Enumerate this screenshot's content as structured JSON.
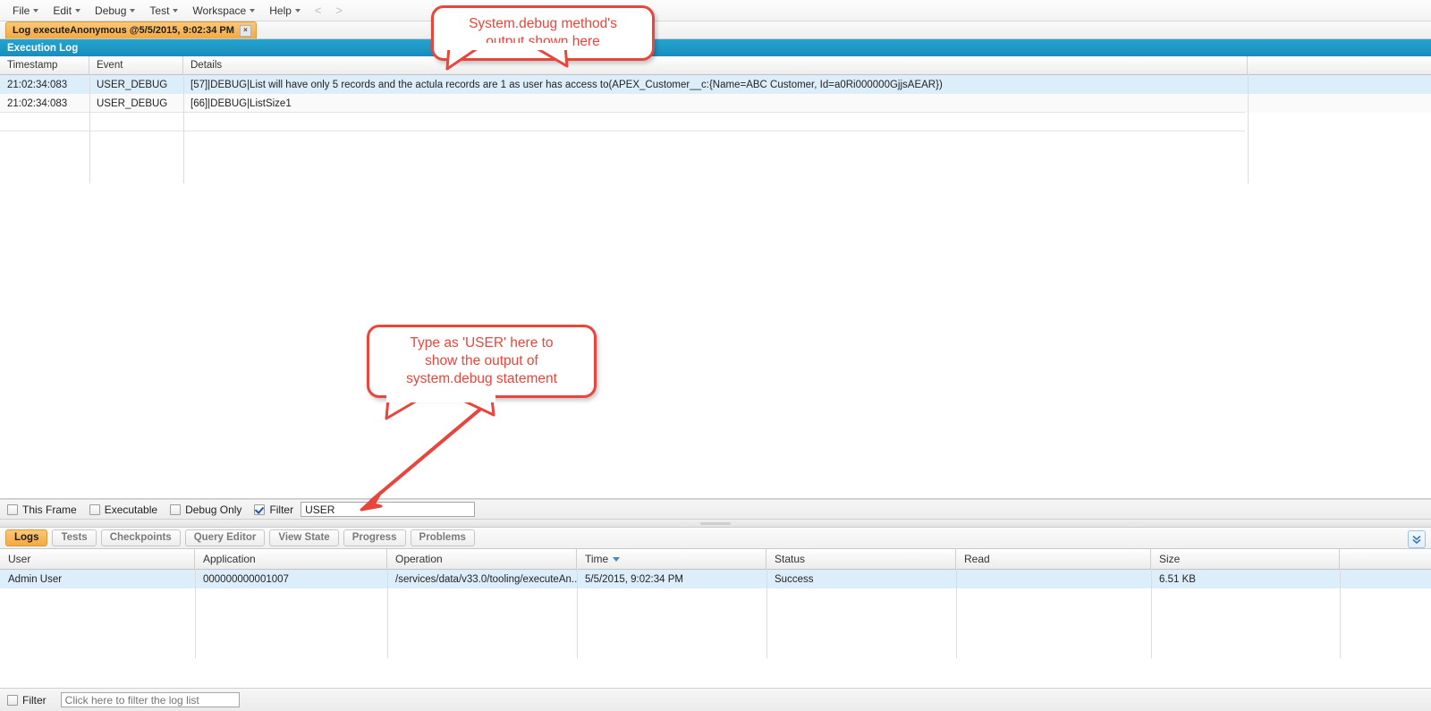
{
  "menu": {
    "items": [
      {
        "label": "File",
        "caret": true
      },
      {
        "label": "Edit",
        "caret": true
      },
      {
        "label": "Debug",
        "caret": true
      },
      {
        "label": "Test",
        "caret": true
      },
      {
        "label": "Workspace",
        "caret": true
      },
      {
        "label": "Help",
        "caret": true
      }
    ],
    "nav_back": "<",
    "nav_forward": ">"
  },
  "document_tab": {
    "title": "Log executeAnonymous @5/5/2015, 9:02:34 PM",
    "close_glyph": "×"
  },
  "execution_log": {
    "panel_title": "Execution Log",
    "columns": [
      "Timestamp",
      "Event",
      "Details"
    ],
    "rows": [
      {
        "timestamp": "21:02:34:083",
        "event": "USER_DEBUG",
        "details": "[57]|DEBUG|List will have only 5 records and the actula records are 1 as user has access to(APEX_Customer__c:{Name=ABC Customer, Id=a0Ri000000GjjsAEAR})"
      },
      {
        "timestamp": "21:02:34:083",
        "event": "USER_DEBUG",
        "details": "[66]|DEBUG|ListSize1"
      }
    ]
  },
  "frame_filter": {
    "this_frame": {
      "label": "This Frame",
      "checked": false
    },
    "executable": {
      "label": "Executable",
      "checked": false
    },
    "debug_only": {
      "label": "Debug Only",
      "checked": false
    },
    "filter": {
      "label": "Filter",
      "checked": true
    },
    "filter_value": "USER",
    "filter_placeholder": ""
  },
  "bottom_tabs": {
    "items": [
      {
        "label": "Logs",
        "active": true
      },
      {
        "label": "Tests",
        "active": false
      },
      {
        "label": "Checkpoints",
        "active": false
      },
      {
        "label": "Query Editor",
        "active": false
      },
      {
        "label": "View State",
        "active": false
      },
      {
        "label": "Progress",
        "active": false
      },
      {
        "label": "Problems",
        "active": false
      }
    ],
    "expand_icon": "chevron-double-down-icon"
  },
  "logs_table": {
    "columns": [
      "User",
      "Application",
      "Operation",
      "Time",
      "Status",
      "Read",
      "Size"
    ],
    "sorted_column": "Time",
    "sort_direction": "desc",
    "rows": [
      {
        "user": "Admin User",
        "application": "000000000001007",
        "operation": "/services/data/v33.0/tooling/executeAn...",
        "time": "5/5/2015, 9:02:34 PM",
        "status": "Success",
        "read": "",
        "size": "6.51 KB"
      }
    ]
  },
  "log_list_filter": {
    "label": "Filter",
    "checked": false,
    "value": "",
    "placeholder": "Click here to filter the log list"
  },
  "annotations": {
    "callout_1": "System.debug method's\noutput shown here",
    "callout_1_line1": "System.debug method's",
    "callout_1_line2": "output shown here",
    "callout_2_line1": "Type as 'USER' here to",
    "callout_2_line2": "show the output of",
    "callout_2_line3": "system.debug statement",
    "accent_color": "#e8453c"
  },
  "colors": {
    "panel_header": "#1e9ac6",
    "tab_active": "#f5a93f",
    "row_selected": "#ddeefb",
    "annotation": "#e8453c"
  }
}
